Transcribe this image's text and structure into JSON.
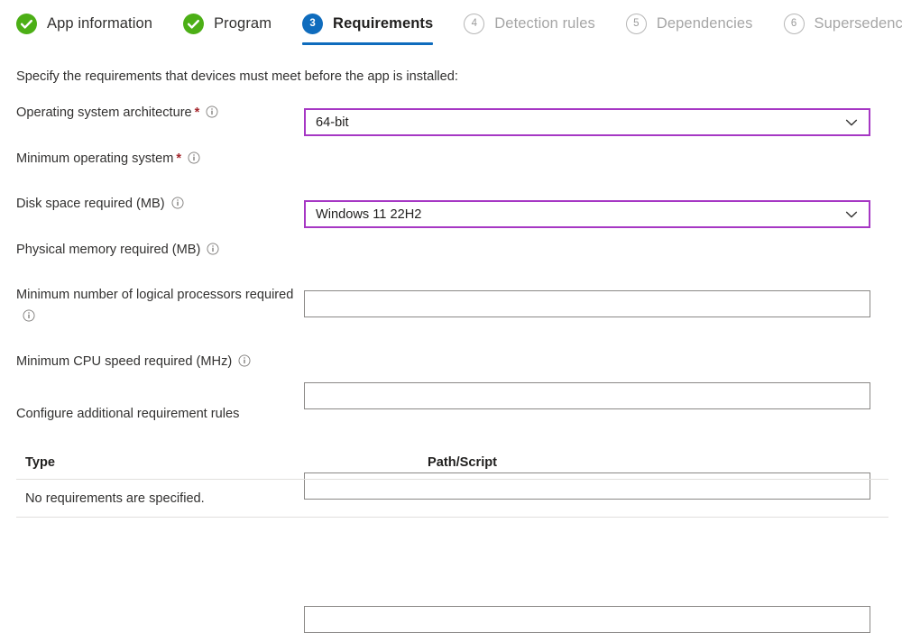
{
  "wizard": {
    "tabs": [
      {
        "label": "App information",
        "state": "done",
        "number": "1",
        "icon": "check-circle-icon"
      },
      {
        "label": "Program",
        "state": "done",
        "number": "2",
        "icon": "check-circle-icon"
      },
      {
        "label": "Requirements",
        "state": "current",
        "number": "3",
        "icon": "step-number-badge"
      },
      {
        "label": "Detection rules",
        "state": "pending",
        "number": "4",
        "icon": "step-number-badge"
      },
      {
        "label": "Dependencies",
        "state": "pending",
        "number": "5",
        "icon": "step-number-badge"
      },
      {
        "label": "Supersedence",
        "state": "pending",
        "number": "6",
        "icon": "step-number-badge"
      }
    ]
  },
  "page": {
    "intro": "Specify the requirements that devices must meet before the app is installed:"
  },
  "fields": [
    {
      "label": "Operating system architecture",
      "required": true,
      "info_icon": "info-icon",
      "control": "dropdown",
      "value": "64-bit",
      "chevron_icon": "chevron-down-icon"
    },
    {
      "label": "Minimum operating system",
      "required": true,
      "info_icon": "info-icon",
      "control": "dropdown",
      "value": "Windows 11 22H2",
      "chevron_icon": "chevron-down-icon"
    },
    {
      "label": "Disk space required (MB)",
      "required": false,
      "info_icon": "info-icon",
      "control": "textbox",
      "value": "",
      "placeholder": ""
    },
    {
      "label": "Physical memory required (MB)",
      "required": false,
      "info_icon": "info-icon",
      "control": "textbox",
      "value": "",
      "placeholder": ""
    },
    {
      "label": "Minimum number of logical processors required",
      "required": false,
      "info_icon": "info-icon",
      "control": "textbox",
      "value": "",
      "placeholder": ""
    },
    {
      "label": "Minimum CPU speed required (MHz)",
      "required": false,
      "info_icon": "info-icon",
      "control": "textbox",
      "value": "",
      "placeholder": ""
    }
  ],
  "rules": {
    "section_title": "Configure additional requirement rules",
    "columns": [
      "Type",
      "Path/Script"
    ],
    "empty_message": "No requirements are specified.",
    "rows": []
  },
  "colors": {
    "accent_blue": "#0f6cbd",
    "success_green": "#4caf16",
    "dropdown_border_purple": "#a637c4",
    "required_red": "#a4262c",
    "text_primary": "#201f1e",
    "text_disabled": "#a6a6a6",
    "border_gray": "#8a8886",
    "divider_gray": "#e1dfdd"
  }
}
